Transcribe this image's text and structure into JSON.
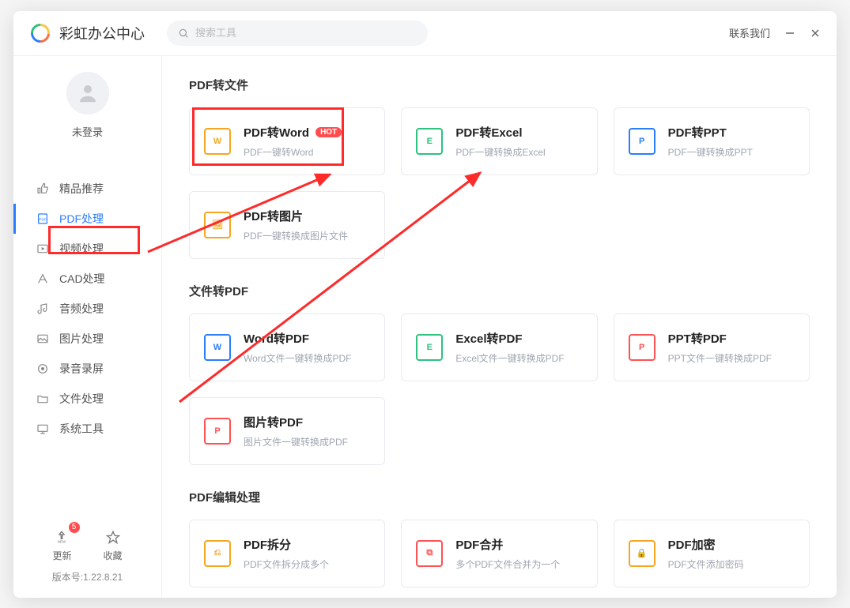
{
  "app": {
    "title": "彩虹办公中心"
  },
  "search": {
    "placeholder": "搜索工具"
  },
  "titlebar": {
    "contact": "联系我们"
  },
  "user": {
    "login_label": "未登录"
  },
  "sidebar": {
    "items": [
      {
        "label": "精品推荐",
        "icon": "thumb-up-icon"
      },
      {
        "label": "PDF处理",
        "icon": "pdf-icon"
      },
      {
        "label": "视频处理",
        "icon": "video-icon"
      },
      {
        "label": "CAD处理",
        "icon": "cad-icon"
      },
      {
        "label": "音频处理",
        "icon": "audio-icon"
      },
      {
        "label": "图片处理",
        "icon": "image-icon"
      },
      {
        "label": "录音录屏",
        "icon": "record-icon"
      },
      {
        "label": "文件处理",
        "icon": "folder-icon"
      },
      {
        "label": "系统工具",
        "icon": "system-icon"
      }
    ],
    "footer": {
      "update_label": "更新",
      "favorite_label": "收藏",
      "badge": "5",
      "version": "版本号:1.22.8.21"
    }
  },
  "sections": [
    {
      "title": "PDF转文件",
      "cards": [
        {
          "title": "PDF转Word",
          "sub": "PDF一键转Word",
          "theme": "orange",
          "glyph": "W",
          "hot": "HOT"
        },
        {
          "title": "PDF转Excel",
          "sub": "PDF一键转换成Excel",
          "theme": "green",
          "glyph": "E"
        },
        {
          "title": "PDF转PPT",
          "sub": "PDF一键转换成PPT",
          "theme": "blue",
          "glyph": "P"
        },
        {
          "title": "PDF转图片",
          "sub": "PDF一键转换成图片文件",
          "theme": "orange",
          "glyph": "🖼"
        }
      ]
    },
    {
      "title": "文件转PDF",
      "cards": [
        {
          "title": "Word转PDF",
          "sub": "Word文件一键转换成PDF",
          "theme": "blue",
          "glyph": "W"
        },
        {
          "title": "Excel转PDF",
          "sub": "Excel文件一键转换成PDF",
          "theme": "green",
          "glyph": "E"
        },
        {
          "title": "PPT转PDF",
          "sub": "PPT文件一键转换成PDF",
          "theme": "red",
          "glyph": "P"
        },
        {
          "title": "图片转PDF",
          "sub": "图片文件一键转换成PDF",
          "theme": "red",
          "glyph": "P"
        }
      ]
    },
    {
      "title": "PDF编辑处理",
      "cards": [
        {
          "title": "PDF拆分",
          "sub": "PDF文件拆分成多个",
          "theme": "orange",
          "glyph": "⎌"
        },
        {
          "title": "PDF合并",
          "sub": "多个PDF文件合并为一个",
          "theme": "red",
          "glyph": "⧉"
        },
        {
          "title": "PDF加密",
          "sub": "PDF文件添加密码",
          "theme": "orange",
          "glyph": "🔒"
        }
      ]
    }
  ]
}
